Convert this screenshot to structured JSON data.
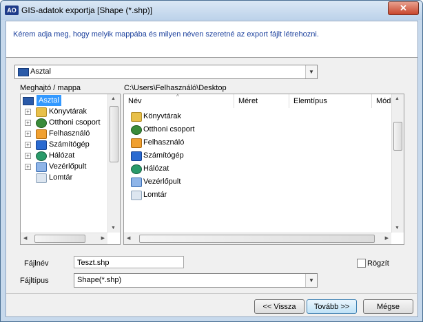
{
  "window": {
    "title": "GIS-adatok exportja [Shape (*.shp)]",
    "app_icon_text": "AO",
    "close_glyph": "✕"
  },
  "header": {
    "instruction": "Kérem adja meg, hogy melyik mappába és milyen néven szeretné az export fájlt létrehozni."
  },
  "location": {
    "value": "Asztal",
    "icon": "desktop-icon"
  },
  "tree": {
    "label": "Meghajtó / mappa",
    "root": "Asztal",
    "items": [
      {
        "label": "Könyvtárak",
        "icon": "libraries-icon",
        "expandable": true
      },
      {
        "label": "Otthoni csoport",
        "icon": "homegroup-icon",
        "expandable": true
      },
      {
        "label": "Felhasználó",
        "icon": "user-folder-icon",
        "expandable": true
      },
      {
        "label": "Számítógép",
        "icon": "computer-icon",
        "expandable": true
      },
      {
        "label": "Hálózat",
        "icon": "network-icon",
        "expandable": true
      },
      {
        "label": "Vezérlőpult",
        "icon": "control-panel-icon",
        "expandable": true
      },
      {
        "label": "Lomtár",
        "icon": "recycle-bin-icon",
        "expandable": false
      }
    ]
  },
  "filelist": {
    "path": "C:\\Users\\Felhasználó\\Desktop",
    "columns": [
      "Név",
      "Méret",
      "Elemtípus",
      "Mód"
    ],
    "items": [
      {
        "label": "Könyvtárak",
        "icon": "libraries-icon"
      },
      {
        "label": "Otthoni csoport",
        "icon": "homegroup-icon"
      },
      {
        "label": "Felhasználó",
        "icon": "user-folder-icon"
      },
      {
        "label": "Számítógép",
        "icon": "computer-icon"
      },
      {
        "label": "Hálózat",
        "icon": "network-icon"
      },
      {
        "label": "Vezérlőpult",
        "icon": "control-panel-icon"
      },
      {
        "label": "Lomtár",
        "icon": "recycle-bin-icon"
      }
    ]
  },
  "form": {
    "filename_label": "Fájlnév",
    "filename_value": "Teszt.shp",
    "filetype_label": "Fájltípus",
    "filetype_value": "Shape(*.shp)",
    "lock_label": "Rögzít",
    "lock_checked": false
  },
  "buttons": {
    "back": "<< Vissza",
    "next": "Tovább >>",
    "cancel": "Mégse"
  }
}
